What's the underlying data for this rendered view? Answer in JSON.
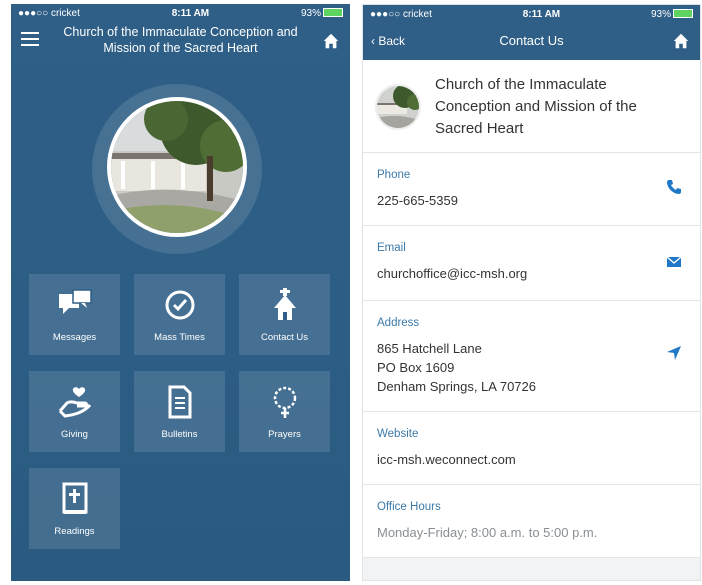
{
  "left": {
    "status": {
      "carrier": "●●●○○ cricket",
      "time": "8:11 AM",
      "battery": "93%"
    },
    "header": {
      "title": "Church of the Immaculate Conception and Mission of the Sacred Heart"
    },
    "tiles": [
      {
        "label": "Messages",
        "icon": "messages-icon"
      },
      {
        "label": "Mass Times",
        "icon": "clock-icon"
      },
      {
        "label": "Contact Us",
        "icon": "church-icon"
      },
      {
        "label": "Giving",
        "icon": "giving-hand-icon"
      },
      {
        "label": "Bulletins",
        "icon": "document-icon"
      },
      {
        "label": "Prayers",
        "icon": "rosary-icon"
      },
      {
        "label": "Readings",
        "icon": "bible-icon"
      }
    ]
  },
  "right": {
    "status": {
      "carrier": "●●●○○ cricket",
      "time": "8:11 AM",
      "battery": "93%"
    },
    "nav": {
      "back_label": "Back",
      "title": "Contact Us"
    },
    "church": {
      "name": "Church of the Immaculate Conception and Mission of the Sacred Heart"
    },
    "phone": {
      "label": "Phone",
      "value": "225-665-5359"
    },
    "email": {
      "label": "Email",
      "value": "churchoffice@icc-msh.org"
    },
    "address": {
      "label": "Address",
      "line1": "865 Hatchell Lane",
      "line2": "PO Box 1609",
      "line3": "Denham Springs, LA 70726"
    },
    "website": {
      "label": "Website",
      "value": "icc-msh.weconnect.com"
    },
    "hours": {
      "label": "Office Hours",
      "value": "Monday-Friday; 8:00 a.m. to 5:00 p.m."
    }
  },
  "colors": {
    "brand": "#2f5f86",
    "accent": "#1f78c8",
    "label": "#3b79a8"
  }
}
